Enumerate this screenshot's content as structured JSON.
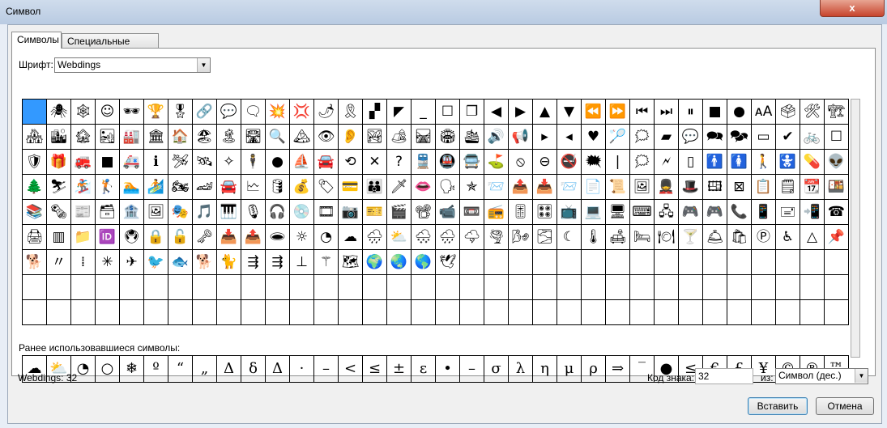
{
  "window": {
    "title": "Символ",
    "close_glyph": "x"
  },
  "tabs": [
    {
      "label": "Символы"
    },
    {
      "label": "Специальные знаки"
    }
  ],
  "font": {
    "label": "Шрифт:",
    "value": "Webdings"
  },
  "grid": {
    "rows": [
      [
        "",
        "🕷",
        "🕸",
        "☺",
        "🕶",
        "🏆",
        "🎖",
        "🔗",
        "💬",
        "🗨",
        "💥",
        "💢",
        "🌶",
        "🎗",
        "▞",
        "◤",
        "_",
        "☐",
        "❐",
        "◀",
        "▶",
        "▲",
        "▼",
        "⏪",
        "⏩",
        "⏮",
        "⏭",
        "⏸",
        "■",
        "●",
        "ᴀA",
        "🗳",
        "🛠",
        "🏗"
      ],
      [
        "🏘",
        "🏙",
        "🏚",
        "🏜",
        "🏭",
        "🏛",
        "🏠",
        "🏖",
        "🏝",
        "🛣",
        "🔍",
        "🏔",
        "👁",
        "👂",
        "🏞",
        "🏕",
        "🛤",
        "🏟",
        "🛳",
        "🔊",
        "📢",
        "▸",
        "◂",
        "♥",
        "🏸",
        "🗯",
        "▰",
        "💬",
        "🗪",
        "🗫",
        "▭",
        "✔",
        "🚲",
        "☐"
      ],
      [
        "🛡",
        "🎁",
        "🚒",
        "■",
        "🚑",
        "ℹ",
        "🛩",
        "🛰",
        "✧",
        "🕴",
        "●",
        "⛵",
        "🚘",
        "⟲",
        "✕",
        "?",
        "🚆",
        "🚇",
        "🚍",
        "⛳",
        "⦸",
        "⊖",
        "🚭",
        "🗮",
        "|",
        "🗯",
        "🗲",
        "▯",
        "🚹",
        "🚺",
        "🚶",
        "🚼",
        "💊",
        "👽"
      ],
      [
        "🌲",
        "⛷",
        "🏂",
        "🏌",
        "🏊",
        "🏄",
        "🏍",
        "🏎",
        "🚘",
        "🗠",
        "🛢",
        "💰",
        "🏷",
        "💳",
        "👪",
        "🗡",
        "👄",
        "🗣",
        "✯",
        "📨",
        "📤",
        "📥",
        "📨",
        "📄",
        "📜",
        "🖼",
        "💂",
        "🎩",
        "🖽",
        "⊠",
        "📋",
        "🗒",
        "📆",
        "🍱"
      ],
      [
        "📚",
        "🗞",
        "📰",
        "🗃",
        "🏦",
        "🖼",
        "🎭",
        "🎵",
        "🎹",
        "🎙",
        "🎧",
        "💿",
        "🎞",
        "📷",
        "🎫",
        "🎬",
        "📽",
        "📹",
        "📼",
        "📻",
        "🎚",
        "🎛",
        "📺",
        "💻",
        "🖥",
        "⌨",
        "🖧",
        "🎮",
        "🎮",
        "📞",
        "📱",
        "🖃",
        "📲",
        "☎"
      ],
      [
        "🖨",
        "▥",
        "📁",
        "🆔",
        "🖲",
        "🔒",
        "🔓",
        "🗝",
        "📥",
        "📤",
        "🕳",
        "☼",
        "◔",
        "☁",
        "🌧",
        "⛅",
        "🌨",
        "🌧",
        "🌩",
        "🌪",
        "🌬",
        "🌫",
        "☾",
        "🌡",
        "🛋",
        "🛏",
        "🍽",
        "🍸",
        "🛎",
        "🛍",
        "Ⓟ",
        "♿",
        "△",
        "📌"
      ],
      [
        "🐕",
        "〃",
        "⁞",
        "✳",
        "✈",
        "🐦",
        "🐟",
        "🐕",
        "🐈",
        "⇶",
        "⇶",
        "⊥",
        "⚚",
        "🗺",
        "🌍",
        "🌏",
        "🌎",
        "🕊",
        "",
        "",
        "",
        "",
        "",
        "",
        "",
        "",
        "",
        "",
        "",
        "",
        "",
        "",
        "",
        ""
      ],
      [
        "",
        "",
        "",
        "",
        "",
        "",
        "",
        "",
        "",
        "",
        "",
        "",
        "",
        "",
        "",
        "",
        "",
        "",
        "",
        "",
        "",
        "",
        "",
        "",
        "",
        "",
        "",
        "",
        "",
        "",
        "",
        "",
        "",
        ""
      ],
      [
        "",
        "",
        "",
        "",
        "",
        "",
        "",
        "",
        "",
        "",
        "",
        "",
        "",
        "",
        "",
        "",
        "",
        "",
        "",
        "",
        "",
        "",
        "",
        "",
        "",
        "",
        "",
        "",
        "",
        "",
        "",
        "",
        "",
        ""
      ]
    ]
  },
  "recent": {
    "label": "Ранее использовавшиеся символы:",
    "items": [
      "☁",
      "⛅",
      "◔",
      "○",
      "❄",
      "º",
      "“",
      "„",
      "Δ",
      "δ",
      "Δ",
      "·",
      "–",
      "<",
      "≤",
      "±",
      "ε",
      "•",
      "–",
      "σ",
      "λ",
      "η",
      "μ",
      "ρ",
      "⇒",
      "‾",
      "●",
      "≤",
      "€",
      "£",
      "¥",
      "©",
      "®",
      "™"
    ]
  },
  "status": {
    "text": "Webdings: 32"
  },
  "code": {
    "label": "Код знака:",
    "value": "32"
  },
  "from": {
    "label": "из:",
    "value": "Символ (дес.)"
  },
  "buttons": {
    "insert": "Вставить",
    "cancel": "Отмена"
  },
  "colors": {
    "selection": "#3399ff",
    "titlebar": "#b9cbe2"
  }
}
